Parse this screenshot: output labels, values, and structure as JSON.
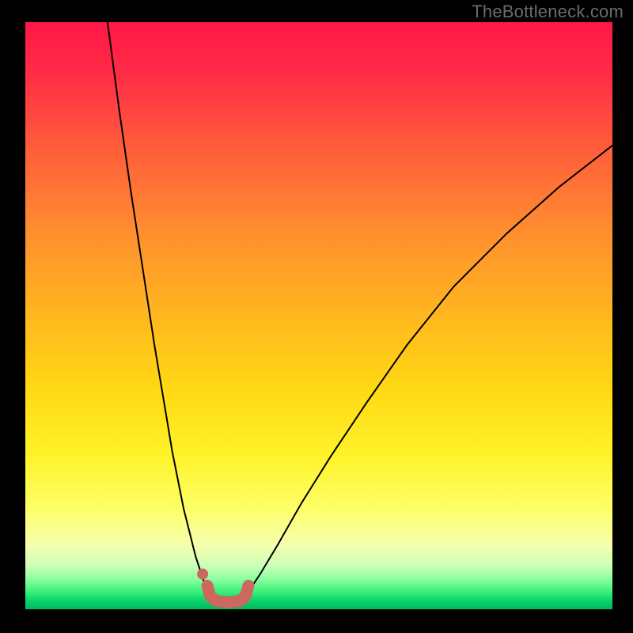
{
  "watermark": "TheBottleneck.com",
  "chart_data": {
    "type": "line",
    "title": "",
    "xlabel": "",
    "ylabel": "",
    "xlim": [
      0,
      100
    ],
    "ylim": [
      0,
      100
    ],
    "grid": false,
    "legend": false,
    "series": [
      {
        "name": "left_curve",
        "x": [
          14,
          16,
          18,
          20,
          22,
          24,
          25,
          26,
          27,
          28,
          29,
          30,
          31
        ],
        "y": [
          100,
          85,
          71,
          58,
          45,
          33,
          27,
          22,
          17,
          13,
          9,
          6,
          3
        ]
      },
      {
        "name": "right_curve",
        "x": [
          38,
          40,
          43,
          47,
          52,
          58,
          65,
          73,
          82,
          91,
          100
        ],
        "y": [
          3,
          6,
          11,
          18,
          26,
          35,
          45,
          55,
          64,
          72,
          79
        ]
      },
      {
        "name": "valley_highlight",
        "x": [
          31,
          31.5,
          32.5,
          34.5,
          36.5,
          37.5,
          38
        ],
        "y": [
          4,
          2.2,
          1.4,
          1.2,
          1.4,
          2.2,
          4
        ],
        "style": "thick-red"
      }
    ],
    "markers": [
      {
        "name": "valley_dot",
        "x": 30.2,
        "y": 6
      }
    ],
    "gradient_stops": [
      {
        "pos": 0.0,
        "color": "#ff1748"
      },
      {
        "pos": 0.5,
        "color": "#ffb71f"
      },
      {
        "pos": 0.74,
        "color": "#fff32a"
      },
      {
        "pos": 0.92,
        "color": "#cfffb8"
      },
      {
        "pos": 1.0,
        "color": "#02b85e"
      }
    ]
  }
}
